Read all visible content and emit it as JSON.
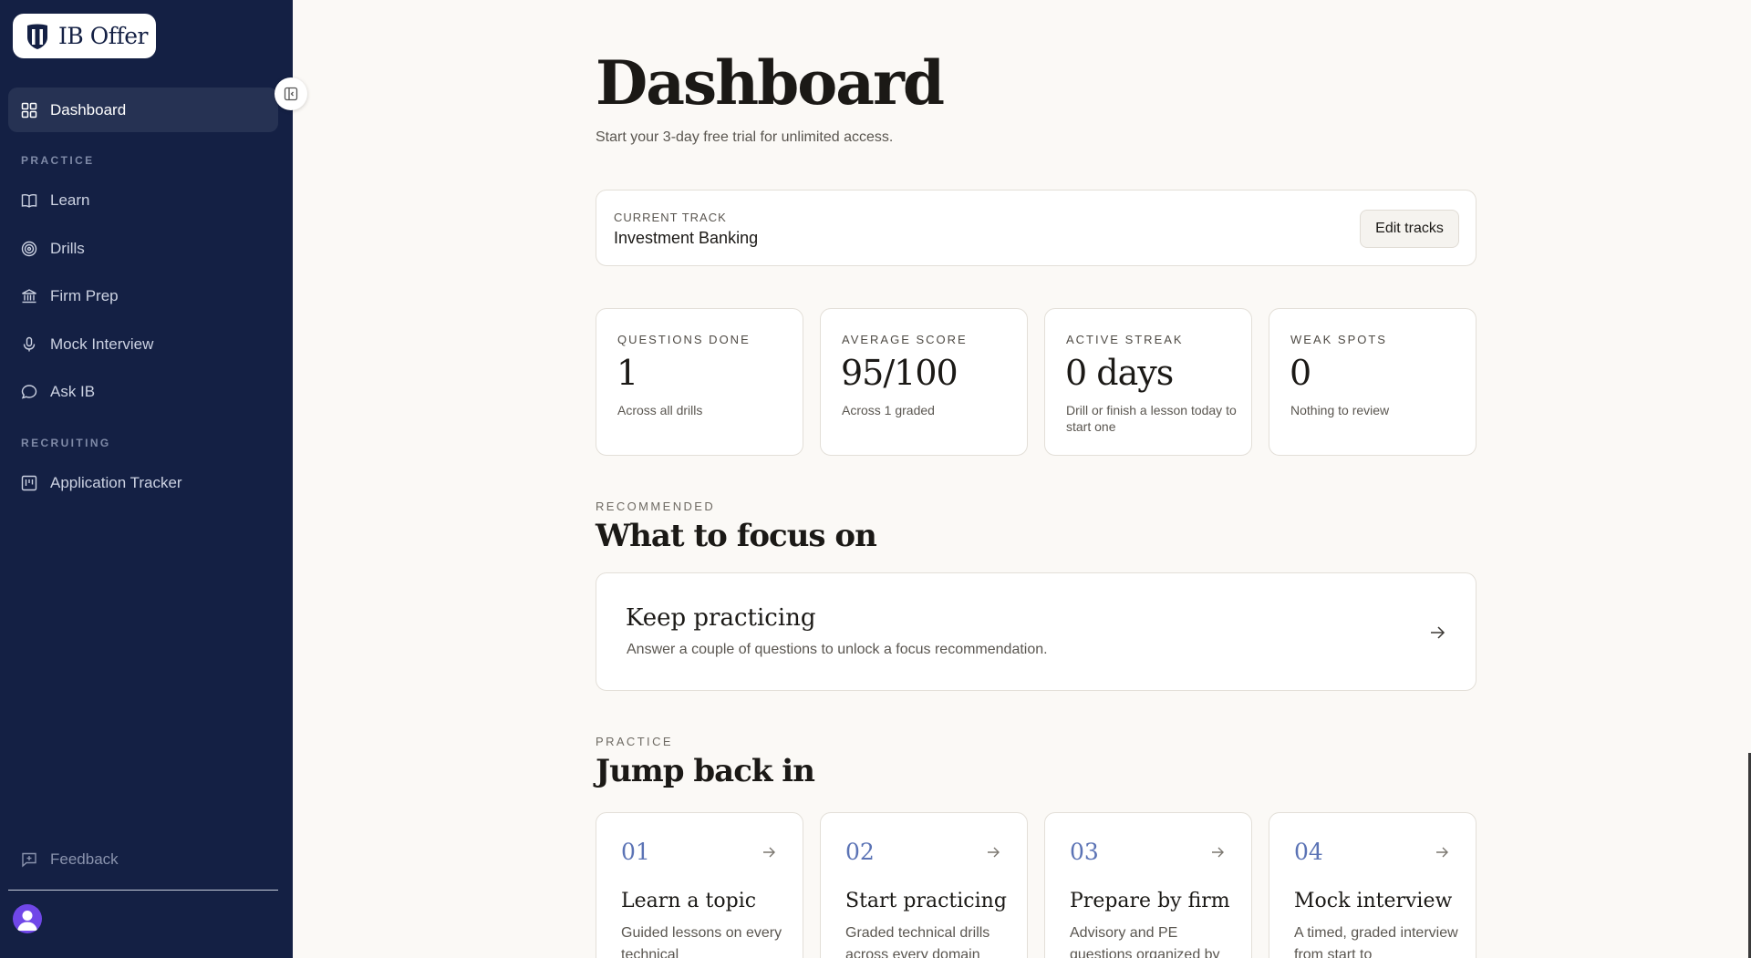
{
  "brand": {
    "name": "IB Offer"
  },
  "sidebar": {
    "dashboard_label": "Dashboard",
    "practice_heading": "PRACTICE",
    "practice_items": [
      {
        "label": "Learn",
        "icon": "book-icon"
      },
      {
        "label": "Drills",
        "icon": "target-icon"
      },
      {
        "label": "Firm Prep",
        "icon": "bank-icon"
      },
      {
        "label": "Mock Interview",
        "icon": "microphone-icon"
      },
      {
        "label": "Ask IB",
        "icon": "chat-bubble-icon"
      }
    ],
    "recruiting_heading": "RECRUITING",
    "recruiting_items": [
      {
        "label": "Application Tracker",
        "icon": "kanban-board-icon"
      }
    ],
    "feedback_label": "Feedback"
  },
  "header": {
    "title": "Dashboard",
    "subtitle": "Start your 3-day free trial for unlimited access."
  },
  "track": {
    "label": "CURRENT TRACK",
    "value": "Investment Banking",
    "edit_label": "Edit tracks"
  },
  "stats": [
    {
      "label": "QUESTIONS DONE",
      "value": "1",
      "note": "Across all drills"
    },
    {
      "label": "AVERAGE SCORE",
      "value": "95/100",
      "note": "Across 1 graded"
    },
    {
      "label": "ACTIVE STREAK",
      "value": "0 days",
      "note": "Drill or finish a lesson today to start one"
    },
    {
      "label": "WEAK SPOTS",
      "value": "0",
      "note": "Nothing to review"
    }
  ],
  "recommended": {
    "eyebrow": "RECOMMENDED",
    "title": "What to focus on",
    "card_title": "Keep practicing",
    "card_subtitle": "Answer a couple of questions to unlock a focus recommendation."
  },
  "practice": {
    "eyebrow": "PRACTICE",
    "title": "Jump back in",
    "cards": [
      {
        "num": "01",
        "title": "Learn a topic",
        "desc": "Guided lessons on every technical"
      },
      {
        "num": "02",
        "title": "Start practicing",
        "desc": "Graded technical drills across every domain"
      },
      {
        "num": "03",
        "title": "Prepare by firm",
        "desc": "Advisory and PE questions organized by"
      },
      {
        "num": "04",
        "title": "Mock interview",
        "desc": "A timed, graded interview from start to"
      }
    ]
  },
  "colors": {
    "sidebar_bg": "#142044",
    "sidebar_active": "#263253",
    "page_bg": "#fbf9f6",
    "accent_number": "#5b73b5",
    "avatar": "#7047e8"
  }
}
